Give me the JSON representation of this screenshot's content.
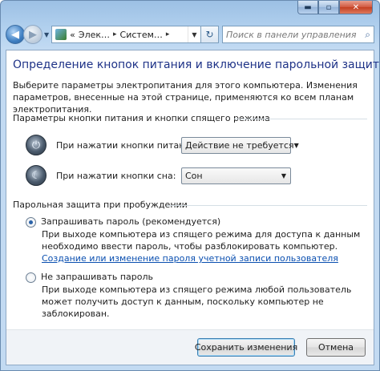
{
  "window": {
    "caption_buttons": {
      "minimize": "▬",
      "maximize": "▫",
      "close": "✕"
    }
  },
  "navbar": {
    "back_icon": "◀",
    "forward_icon": "▶",
    "dropdown_icon": "▼",
    "breadcrumb": [
      "Элек…",
      "Систем…"
    ],
    "breadcrumb_prefix": "«",
    "crumb_sep": "▸",
    "refresh_icon": "↻",
    "search_placeholder": "Поиск в панели управления",
    "search_icon": "⌕"
  },
  "page": {
    "title": "Определение кнопок питания и включение парольной защиты",
    "intro": "Выберите параметры электропитания для этого компьютера. Изменения параметров, внесенные на этой странице, применяются ко всем планам электропитания."
  },
  "power_buttons": {
    "group_title": "Параметры кнопки питания и кнопки спящего режима",
    "power_label": "При нажатии кнопки питания:",
    "power_value": "Действие не требуется",
    "sleep_label": "При нажатии кнопки сна:",
    "sleep_value": "Сон",
    "power_glyph": "⏻",
    "sleep_glyph": "☾"
  },
  "password": {
    "group_title": "Парольная защита при пробуждении",
    "option1_label": "Запрашивать пароль (рекомендуется)",
    "option1_desc": "При выходе компьютера из спящего режима для доступа к данным необходимо ввести пароль, чтобы разблокировать компьютер.",
    "option1_link": "Создание или изменение пароля учетной записи пользователя",
    "option2_label": "Не запрашивать пароль",
    "option2_desc": "При выходе компьютера из спящего режима любой пользователь может получить доступ к данным, поскольку компьютер не заблокирован.",
    "selected": "option1"
  },
  "footer": {
    "save_label": "Сохранить изменения",
    "cancel_label": "Отмена"
  }
}
